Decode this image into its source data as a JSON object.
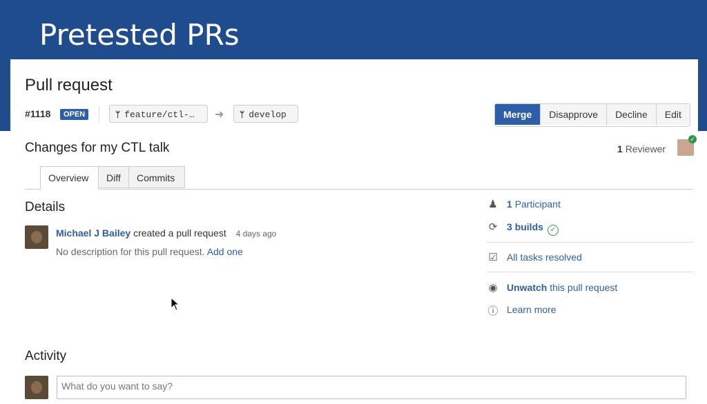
{
  "slide": {
    "title": "Pretested PRs"
  },
  "pr": {
    "heading": "Pull request",
    "number": "#1118",
    "status": "OPEN",
    "source_branch": "feature/ctl-…",
    "target_branch": "develop",
    "title": "Changes for my CTL talk",
    "reviewer_count": "1",
    "reviewer_label": "Reviewer"
  },
  "actions": {
    "merge": "Merge",
    "disapprove": "Disapprove",
    "decline": "Decline",
    "edit": "Edit"
  },
  "tabs": [
    {
      "label": "Overview"
    },
    {
      "label": "Diff"
    },
    {
      "label": "Commits"
    }
  ],
  "details": {
    "heading": "Details",
    "author": "Michael J Bailey",
    "action": "created a pull request",
    "time": "4 days ago",
    "no_description": "No description for this pull request.",
    "add_link": "Add one"
  },
  "sidebar": {
    "participants_count": "1",
    "participants_label": "Participant",
    "builds_count": "3",
    "builds_label": "builds",
    "tasks": "All tasks resolved",
    "unwatch": "Unwatch",
    "unwatch_rest": "this pull request",
    "learn_more": "Learn more"
  },
  "activity": {
    "heading": "Activity",
    "comment_placeholder": "What do you want to say?"
  },
  "colors": {
    "banner": "#1f4c8d",
    "primary": "#2c5ea9",
    "success": "#2d9a4b"
  },
  "icons": [
    "branch-icon",
    "arrow-right-icon",
    "person-icon",
    "refresh-icon",
    "check-circle-icon",
    "checkbox-icon",
    "eye-icon",
    "help-icon",
    "mouse-cursor-icon"
  ]
}
